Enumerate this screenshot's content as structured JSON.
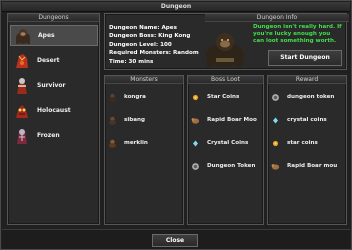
{
  "window": {
    "title": "Dungeon"
  },
  "dungeons": {
    "header": "Dungeons",
    "items": [
      {
        "label": "Apes",
        "selected": true,
        "icon": "ape-icon"
      },
      {
        "label": "Desert",
        "selected": false,
        "icon": "desert-monster-icon"
      },
      {
        "label": "Survivor",
        "selected": false,
        "icon": "survivor-icon"
      },
      {
        "label": "Holocaust",
        "selected": false,
        "icon": "holocaust-icon"
      },
      {
        "label": "Frozen",
        "selected": false,
        "icon": "frozen-icon"
      }
    ]
  },
  "info": {
    "header": "Dungeon Info",
    "lines": [
      "Dungeon Name: Apes",
      "Dungeon Boss: King Kong",
      "Dungeon Level: 100",
      "Required Monsters: Random",
      "Time: 30 mins"
    ],
    "message": "Dungeon isn't really hard. If you're lucky enough you can loot something worth.",
    "start_label": "Start Dungeon"
  },
  "monsters": {
    "header": "Monsters",
    "items": [
      {
        "label": "kongra",
        "icon": "ape-icon"
      },
      {
        "label": "sibang",
        "icon": "ape-icon"
      },
      {
        "label": "merklin",
        "icon": "ape-icon"
      }
    ]
  },
  "boss_loot": {
    "header": "Boss Loot",
    "items": [
      {
        "label": "Star Coins",
        "icon": "star-coin-icon"
      },
      {
        "label": "Rapid Boar Moo",
        "icon": "boar-mount-icon"
      },
      {
        "label": "Crystal Coins",
        "icon": "crystal-coin-icon"
      },
      {
        "label": "Dungeon Token",
        "icon": "dungeon-token-icon"
      }
    ]
  },
  "reward": {
    "header": "Reward",
    "items": [
      {
        "label": "dungeon token",
        "icon": "dungeon-token-icon"
      },
      {
        "label": "crystal coins",
        "icon": "crystal-coin-icon"
      },
      {
        "label": "star coins",
        "icon": "star-coin-icon"
      },
      {
        "label": "Rapid Boar mou",
        "icon": "boar-mount-icon"
      }
    ]
  },
  "footer": {
    "close_label": "Close"
  },
  "colors": {
    "message": "#3fe04a",
    "background": "#202020",
    "panel": "#2a2a2a",
    "border": "#555555"
  }
}
